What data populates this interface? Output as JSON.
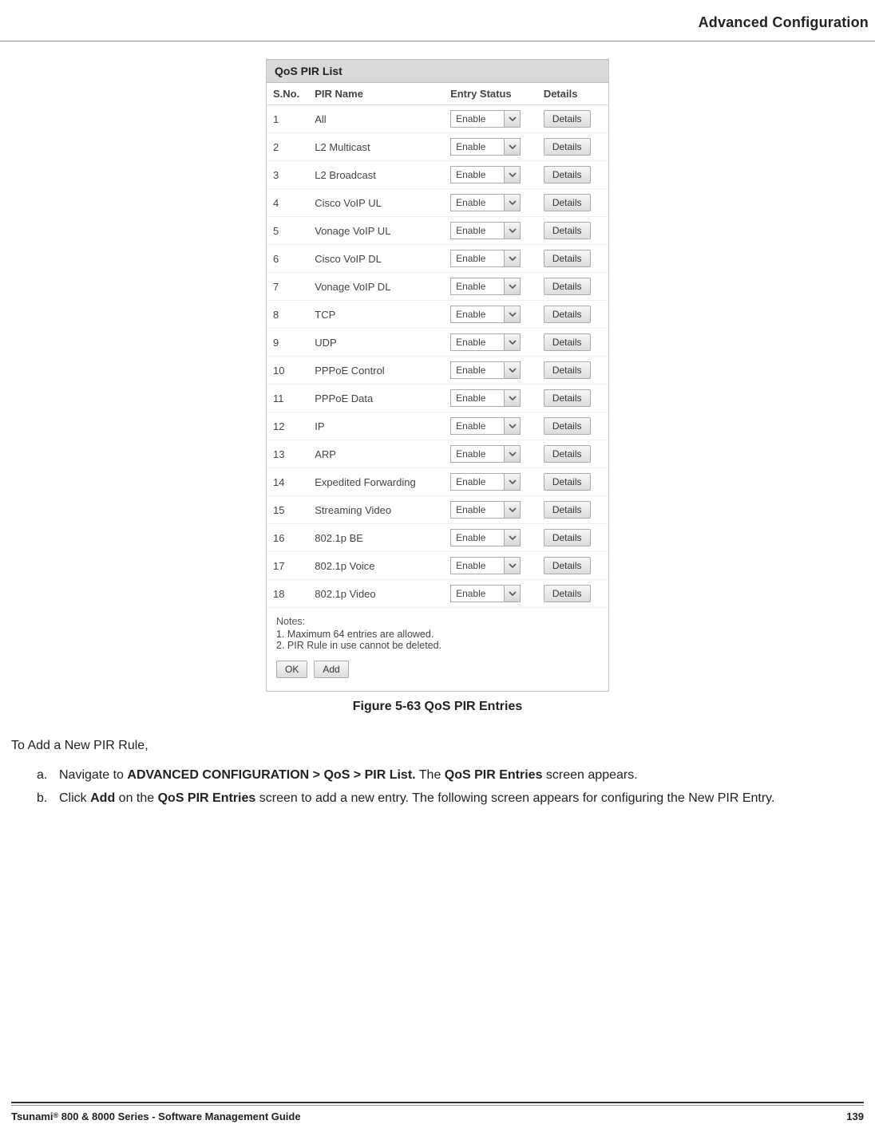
{
  "header": {
    "title": "Advanced Configuration"
  },
  "panel": {
    "title": "QoS PIR List",
    "columns": {
      "sno": "S.No.",
      "name": "PIR Name",
      "status": "Entry Status",
      "details": "Details"
    },
    "status_value": "Enable",
    "details_button": "Details",
    "rows": [
      {
        "sno": "1",
        "name": "All"
      },
      {
        "sno": "2",
        "name": "L2 Multicast"
      },
      {
        "sno": "3",
        "name": "L2 Broadcast"
      },
      {
        "sno": "4",
        "name": "Cisco VoIP UL"
      },
      {
        "sno": "5",
        "name": "Vonage VoIP UL"
      },
      {
        "sno": "6",
        "name": "Cisco VoIP DL"
      },
      {
        "sno": "7",
        "name": "Vonage VoIP DL"
      },
      {
        "sno": "8",
        "name": "TCP"
      },
      {
        "sno": "9",
        "name": "UDP"
      },
      {
        "sno": "10",
        "name": "PPPoE Control"
      },
      {
        "sno": "11",
        "name": "PPPoE Data"
      },
      {
        "sno": "12",
        "name": "IP"
      },
      {
        "sno": "13",
        "name": "ARP"
      },
      {
        "sno": "14",
        "name": "Expedited Forwarding"
      },
      {
        "sno": "15",
        "name": "Streaming Video"
      },
      {
        "sno": "16",
        "name": "802.1p BE"
      },
      {
        "sno": "17",
        "name": "802.1p Voice"
      },
      {
        "sno": "18",
        "name": "802.1p Video"
      }
    ],
    "notes": {
      "heading": "Notes:",
      "line1": "1. Maximum 64 entries are allowed.",
      "line2": "2. PIR Rule in use cannot be deleted."
    },
    "buttons": {
      "ok": "OK",
      "add": "Add"
    }
  },
  "caption": "Figure 5-63 QoS PIR Entries",
  "body": {
    "lead": "To Add a New PIR Rule,",
    "step_a": {
      "marker": "a.",
      "t1": "Navigate to ",
      "bold1": "ADVANCED CONFIGURATION > QoS > PIR List.",
      "t2": " The ",
      "bold2": "QoS PIR Entries",
      "t3": " screen appears."
    },
    "step_b": {
      "marker": "b.",
      "t1": "Click ",
      "bold1": "Add",
      "t2": " on the ",
      "bold2": "QoS PIR Entries",
      "t3": " screen to add a new entry. The following screen appears for configuring the New PIR Entry."
    }
  },
  "footer": {
    "left1": "Tsunami",
    "left2": " 800 & 8000 Series - Software Management Guide",
    "page": "139"
  }
}
